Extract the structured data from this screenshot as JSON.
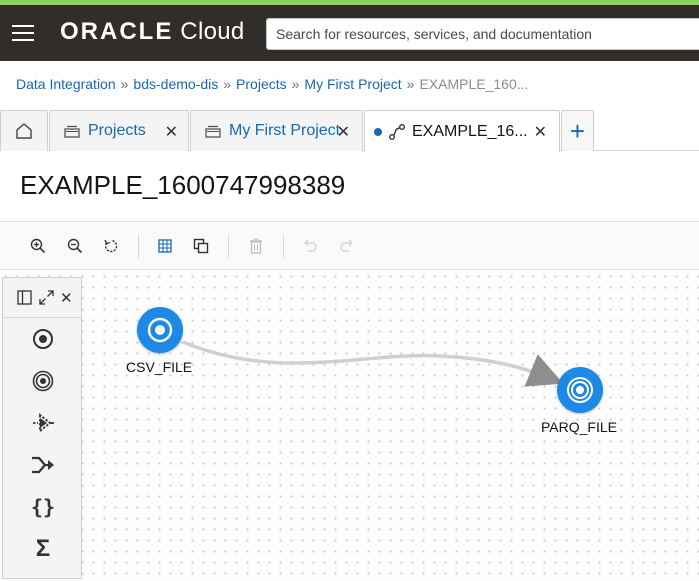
{
  "header": {
    "brand_oracle": "ORACLE",
    "brand_cloud": " Cloud",
    "search_placeholder": "Search for resources, services, and documentation"
  },
  "breadcrumb": {
    "items": [
      "Data Integration",
      "bds-demo-dis",
      "Projects",
      "My First Project"
    ],
    "current": "EXAMPLE_160...",
    "separator": "»"
  },
  "tabs": [
    {
      "label": "Projects",
      "icon": "folder-stack-icon"
    },
    {
      "label": "My First Project",
      "icon": "folder-stack-icon"
    },
    {
      "label": "EXAMPLE_16...",
      "icon": "dataflow-icon",
      "modified": true,
      "active": true
    }
  ],
  "tab_close_glyph": "✕",
  "add_tab_glyph": "+",
  "page": {
    "title": "EXAMPLE_1600747998389"
  },
  "toolbar": {
    "icons": [
      "zoom-in-icon",
      "zoom-out-icon",
      "reset-icon",
      "grid-icon",
      "copy-icon",
      "delete-icon",
      "undo-icon",
      "redo-icon"
    ]
  },
  "palette": {
    "icons": [
      "source-icon",
      "target-icon",
      "filter-icon",
      "join-icon",
      "expression-icon",
      "aggregate-icon"
    ],
    "curly_glyph": "{}",
    "sigma_glyph": "Σ"
  },
  "canvas": {
    "nodes": [
      {
        "label": "CSV_FILE",
        "kind": "source"
      },
      {
        "label": "PARQ_FILE",
        "kind": "target"
      }
    ]
  },
  "colors": {
    "topbar": "#312d2a",
    "link": "#1669b1",
    "node": "#1e88e5",
    "accent": "#8fd16a"
  }
}
